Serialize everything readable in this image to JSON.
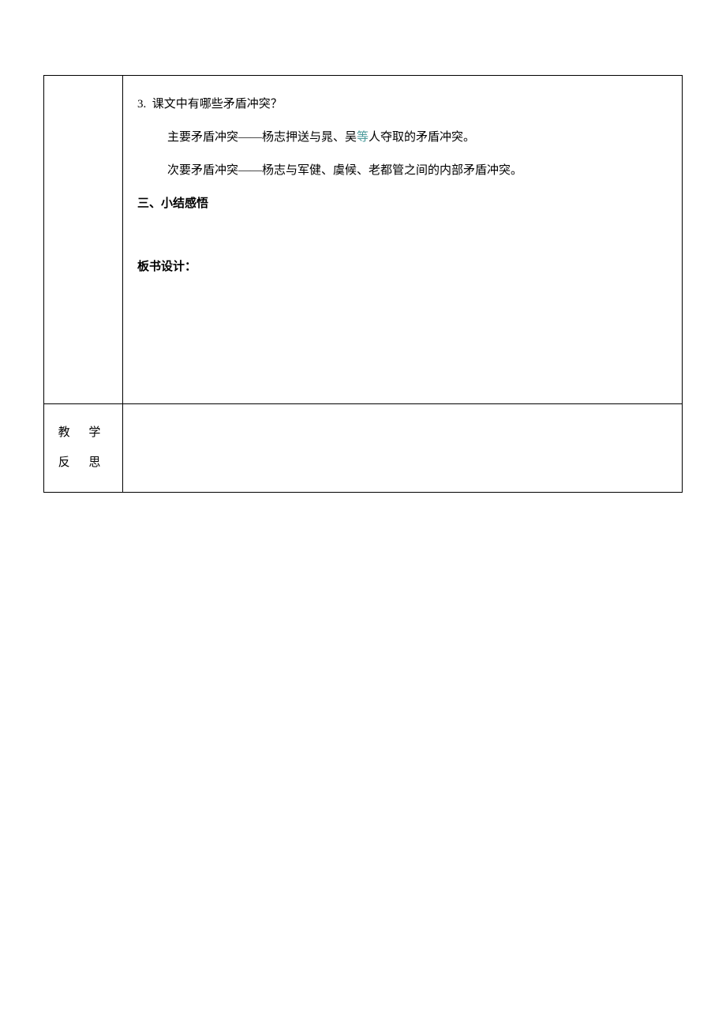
{
  "content": {
    "question_number": "3.",
    "question_text": "课文中有哪些矛盾冲突？",
    "answer1_prefix": "主要矛盾冲突——杨志押送与晁、吴",
    "answer1_teal": "等",
    "answer1_suffix": "人夺取的矛盾冲突。",
    "answer2": "次要矛盾冲突——杨志与军健、虞候、老都管之间的内部矛盾冲突。",
    "section_heading": "三、小结感悟",
    "board_design": "板书设计："
  },
  "reflection": {
    "label_line1": "教",
    "label_line2": "学",
    "label_line3": "反",
    "label_line4": "思"
  }
}
